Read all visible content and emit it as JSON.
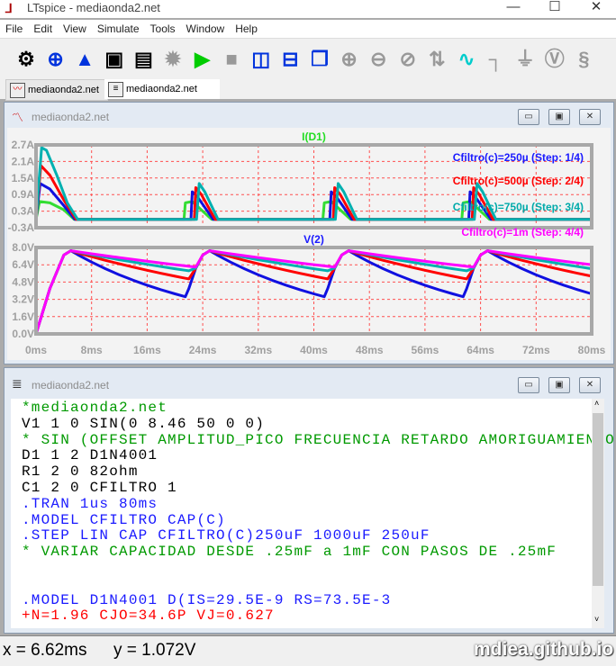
{
  "window": {
    "title": "LTspice - mediaonda2.net",
    "minimize": "—",
    "maximize": "☐",
    "close": "✕"
  },
  "menu": [
    "File",
    "Edit",
    "View",
    "Simulate",
    "Tools",
    "Window",
    "Help"
  ],
  "toolbar": [
    {
      "icon": "gear-icon",
      "glyph": "⚙",
      "color": "#000"
    },
    {
      "icon": "new-schematic-icon",
      "glyph": "⊕",
      "color": "#0033dd"
    },
    {
      "icon": "open-folder-icon",
      "glyph": "▲",
      "color": "#0033dd"
    },
    {
      "icon": "save-icon",
      "glyph": "▣",
      "color": "#000"
    },
    {
      "icon": "print-icon",
      "glyph": "▤",
      "color": "#000"
    },
    {
      "icon": "halt-icon",
      "glyph": "✹",
      "color": "#999"
    },
    {
      "icon": "run-icon",
      "glyph": "▶",
      "color": "#00cc00"
    },
    {
      "icon": "stop-icon",
      "glyph": "■",
      "color": "#999"
    },
    {
      "icon": "tile-vertical-icon",
      "glyph": "◫",
      "color": "#0033dd"
    },
    {
      "icon": "tile-horizontal-icon",
      "glyph": "⊟",
      "color": "#0033dd"
    },
    {
      "icon": "cascade-icon",
      "glyph": "❐",
      "color": "#0033dd"
    },
    {
      "icon": "zoom-in-icon",
      "glyph": "⊕",
      "color": "#999"
    },
    {
      "icon": "zoom-out-icon",
      "glyph": "⊖",
      "color": "#999"
    },
    {
      "icon": "zoom-fit-icon",
      "glyph": "⊘",
      "color": "#999"
    },
    {
      "icon": "autorange-icon",
      "glyph": "⇅",
      "color": "#999"
    },
    {
      "icon": "waveform-icon",
      "glyph": "∿",
      "color": "#00cccc"
    },
    {
      "icon": "wire-icon",
      "glyph": "┐",
      "color": "#999"
    },
    {
      "icon": "ground-icon",
      "glyph": "⏚",
      "color": "#999"
    },
    {
      "icon": "voltage-probe-icon",
      "glyph": "Ⓥ",
      "color": "#999"
    },
    {
      "icon": "resistor-icon",
      "glyph": "§",
      "color": "#999"
    }
  ],
  "tabs": [
    {
      "label": "mediaonda2.net",
      "icon": "waveform-tab-icon"
    },
    {
      "label": "mediaonda2.net",
      "icon": "netlist-tab-icon",
      "active": true
    }
  ],
  "plot_window": {
    "title": "mediaonda2.net"
  },
  "netlist_window": {
    "title": "mediaonda2.net"
  },
  "netlist": [
    {
      "text": "*mediaonda2.net",
      "color": "#009900"
    },
    {
      "text": "V1 1 0 SIN(0 8.46 50 0 0)",
      "color": "#000000"
    },
    {
      "text": "* SIN (OFFSET AMPLITUD_PICO FRECUENCIA RETARDO AMORIGUAMIENTO)",
      "color": "#009900"
    },
    {
      "text": "D1 1 2 D1N4001",
      "color": "#000000"
    },
    {
      "text": "R1 2 0 82ohm",
      "color": "#000000"
    },
    {
      "text": "C1 2 0 CFILTRO 1",
      "color": "#000000"
    },
    {
      "text": ".TRAN 1us 80ms",
      "color": "#1a1aff"
    },
    {
      "text": ".MODEL CFILTRO CAP(C)",
      "color": "#1a1aff"
    },
    {
      "text": ".STEP LIN CAP CFILTRO(C)250uF 1000uF 250uF",
      "color": "#1a1aff"
    },
    {
      "text": "* VARIAR CAPACIDAD DESDE .25mF a 1mF CON PASOS DE .25mF",
      "color": "#009900"
    },
    {
      "text": "",
      "color": "#000000"
    },
    {
      "text": "",
      "color": "#000000"
    },
    {
      "text": ".MODEL D1N4001 D(IS=29.5E-9 RS=73.5E-3",
      "color": "#1a1aff"
    },
    {
      "text": "+N=1.96 CJO=34.6P VJ=0.627",
      "color": "#ff0000"
    }
  ],
  "status": {
    "x": "x = 6.62ms",
    "y": "y = 1.072V",
    "watermark": "mdiea.github.io"
  },
  "chart_data": [
    {
      "type": "line",
      "title": "I(D1)",
      "title_color": "#22dd22",
      "xlim": [
        0,
        80
      ],
      "ylim": [
        -0.3,
        2.7
      ],
      "xticks": [
        "0ms",
        "8ms",
        "16ms",
        "24ms",
        "32ms",
        "40ms",
        "48ms",
        "56ms",
        "64ms",
        "72ms",
        "80ms"
      ],
      "yticks": [
        "2.7A",
        "2.1A",
        "1.5A",
        "0.9A",
        "0.3A",
        "-0.3A"
      ],
      "grid": true,
      "series": [
        {
          "color": "#33dd33",
          "points": [
            [
              0,
              0
            ],
            [
              0.5,
              0.65
            ],
            [
              2,
              0.6
            ],
            [
              4,
              0.35
            ],
            [
              5.5,
              0
            ],
            [
              21.3,
              0
            ],
            [
              21.5,
              0.6
            ],
            [
              22.5,
              0.65
            ],
            [
              24,
              0.3
            ],
            [
              25.3,
              0
            ],
            [
              41.3,
              0
            ],
            [
              41.5,
              0.6
            ],
            [
              42.5,
              0.65
            ],
            [
              44,
              0.3
            ],
            [
              45.3,
              0
            ],
            [
              61.3,
              0
            ],
            [
              61.5,
              0.6
            ],
            [
              62.5,
              0.65
            ],
            [
              64,
              0.3
            ],
            [
              65.3,
              0
            ],
            [
              80,
              0
            ]
          ]
        },
        {
          "color": "#1010e0",
          "points": [
            [
              0,
              0
            ],
            [
              0.6,
              1.3
            ],
            [
              2,
              1.1
            ],
            [
              4,
              0.5
            ],
            [
              5.6,
              0
            ],
            [
              22.3,
              0
            ],
            [
              22.5,
              1.0
            ],
            [
              23.3,
              0.8
            ],
            [
              25.5,
              0
            ],
            [
              42.3,
              0
            ],
            [
              42.5,
              1.0
            ],
            [
              43.3,
              0.8
            ],
            [
              45.5,
              0
            ],
            [
              62.3,
              0
            ],
            [
              62.5,
              1.0
            ],
            [
              63.3,
              0.8
            ],
            [
              65.5,
              0
            ],
            [
              80,
              0
            ]
          ]
        },
        {
          "color": "#ff0000",
          "points": [
            [
              0,
              0
            ],
            [
              0.7,
              1.95
            ],
            [
              2,
              1.6
            ],
            [
              4,
              0.7
            ],
            [
              5.8,
              0
            ],
            [
              22.8,
              0
            ],
            [
              23,
              1.15
            ],
            [
              23.8,
              0.9
            ],
            [
              25.8,
              0
            ],
            [
              42.8,
              0
            ],
            [
              43,
              1.15
            ],
            [
              43.8,
              0.9
            ],
            [
              45.8,
              0
            ],
            [
              62.8,
              0
            ],
            [
              63,
              1.15
            ],
            [
              63.8,
              0.9
            ],
            [
              65.8,
              0
            ],
            [
              80,
              0
            ]
          ]
        },
        {
          "color": "#00b0b0",
          "points": [
            [
              0,
              0
            ],
            [
              0.8,
              2.6
            ],
            [
              1.5,
              2.5
            ],
            [
              3,
              1.6
            ],
            [
              4.5,
              0.6
            ],
            [
              6,
              0
            ],
            [
              23.1,
              0
            ],
            [
              23.5,
              1.3
            ],
            [
              24.3,
              1.0
            ],
            [
              26.2,
              0
            ],
            [
              43.1,
              0
            ],
            [
              43.5,
              1.3
            ],
            [
              44.3,
              1.0
            ],
            [
              46.2,
              0
            ],
            [
              63.1,
              0
            ],
            [
              63.5,
              1.3
            ],
            [
              64.3,
              1.0
            ],
            [
              66.2,
              0
            ],
            [
              80,
              0
            ]
          ]
        }
      ],
      "legend": [
        {
          "text": "Cfiltro(c)=250µ  (Step: 1/4)",
          "color": "#1a1aff"
        },
        {
          "text": "Cfiltro(c)=500µ  (Step: 2/4)",
          "color": "#ff0000"
        },
        {
          "text": "Cfiltro(c)=750µ  (Step: 3/4)",
          "color": "#00aaaa"
        },
        {
          "text": "Cfiltro(c)=1m  (Step: 4/4)",
          "color": "#ff00ff"
        }
      ],
      "legend_placement": "right"
    },
    {
      "type": "line",
      "title": "V(2)",
      "title_color": "#1a1aff",
      "xlim": [
        0,
        80
      ],
      "ylim": [
        0,
        8
      ],
      "xticks": [
        "0ms",
        "8ms",
        "16ms",
        "24ms",
        "32ms",
        "40ms",
        "48ms",
        "56ms",
        "64ms",
        "72ms",
        "80ms"
      ],
      "yticks": [
        "8.0V",
        "6.4V",
        "4.8V",
        "3.2V",
        "1.6V",
        "0.0V"
      ],
      "grid": true,
      "x": [
        0,
        2,
        4,
        5,
        6,
        8,
        10,
        12,
        14,
        16,
        18,
        20,
        21.5,
        22,
        23,
        24,
        25,
        26,
        28,
        30,
        32,
        34,
        36,
        38,
        40,
        41.5,
        42,
        43,
        44,
        45,
        46,
        48,
        50,
        52,
        54,
        56,
        58,
        60,
        61.5,
        62,
        63,
        64,
        65,
        66,
        68,
        70,
        72,
        74,
        76,
        78,
        80
      ],
      "series": [
        {
          "color": "#1010e0",
          "values": [
            0,
            4.2,
            7.3,
            7.7,
            7.33,
            6.65,
            6.03,
            5.47,
            4.97,
            4.51,
            4.09,
            3.71,
            3.44,
            4.2,
            6.09,
            7.3,
            7.7,
            7.33,
            6.65,
            6.03,
            5.47,
            4.97,
            4.51,
            4.09,
            3.71,
            3.44,
            4.2,
            6.09,
            7.3,
            7.7,
            7.33,
            6.65,
            6.03,
            5.47,
            4.97,
            4.51,
            4.09,
            3.71,
            3.44,
            4.2,
            6.09,
            7.3,
            7.7,
            7.33,
            6.65,
            6.03,
            5.47,
            4.97,
            4.51,
            4.09,
            3.71
          ]
        },
        {
          "color": "#ff0000",
          "values": [
            0,
            4.2,
            7.3,
            7.7,
            7.51,
            7.15,
            6.81,
            6.49,
            6.18,
            5.89,
            5.61,
            5.34,
            5.15,
            5.09,
            6.09,
            7.3,
            7.7,
            7.51,
            7.15,
            6.81,
            6.49,
            6.18,
            5.89,
            5.61,
            5.34,
            5.15,
            5.09,
            6.09,
            7.3,
            7.7,
            7.51,
            7.15,
            6.81,
            6.49,
            6.18,
            5.89,
            5.61,
            5.34,
            5.15,
            5.09,
            6.09,
            7.3,
            7.7,
            7.51,
            7.15,
            6.81,
            6.49,
            6.18,
            5.89,
            5.61,
            5.34
          ]
        },
        {
          "color": "#00b0b0",
          "values": [
            0,
            4.2,
            7.3,
            7.7,
            7.58,
            7.33,
            7.1,
            6.87,
            6.65,
            6.44,
            6.23,
            6.03,
            5.89,
            5.84,
            6.09,
            7.3,
            7.7,
            7.58,
            7.33,
            7.1,
            6.87,
            6.65,
            6.44,
            6.23,
            6.03,
            5.89,
            5.84,
            6.09,
            7.3,
            7.7,
            7.58,
            7.33,
            7.1,
            6.87,
            6.65,
            6.44,
            6.23,
            6.03,
            5.89,
            5.84,
            6.09,
            7.3,
            7.7,
            7.58,
            7.33,
            7.1,
            6.87,
            6.65,
            6.44,
            6.23,
            6.03
          ]
        },
        {
          "color": "#ff00ff",
          "values": [
            0,
            4.2,
            7.3,
            7.7,
            7.61,
            7.42,
            7.24,
            7.07,
            6.9,
            6.73,
            6.57,
            6.41,
            6.3,
            6.26,
            6.18,
            7.3,
            7.7,
            7.61,
            7.42,
            7.24,
            7.07,
            6.9,
            6.73,
            6.57,
            6.41,
            6.3,
            6.26,
            6.18,
            7.3,
            7.7,
            7.61,
            7.42,
            7.24,
            7.07,
            6.9,
            6.73,
            6.57,
            6.41,
            6.3,
            6.26,
            6.18,
            7.3,
            7.7,
            7.61,
            7.42,
            7.24,
            7.07,
            6.9,
            6.73,
            6.57,
            6.41
          ]
        }
      ]
    }
  ]
}
